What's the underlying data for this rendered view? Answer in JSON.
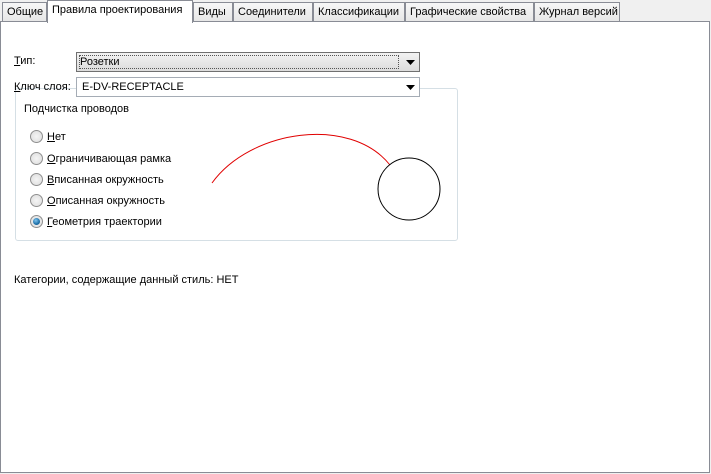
{
  "tabs": [
    {
      "label": "Общие",
      "active": false
    },
    {
      "label": "Правила проектирования",
      "active": true
    },
    {
      "label": "Виды",
      "active": false
    },
    {
      "label": "Соединители",
      "active": false
    },
    {
      "label": "Классификации",
      "active": false
    },
    {
      "label": "Графические свойства",
      "active": false
    },
    {
      "label": "Журнал версий",
      "active": false
    }
  ],
  "type_field": {
    "label_first": "Т",
    "label_rest": "ип:",
    "value": "Розетки"
  },
  "layer_key_field": {
    "label_first": "К",
    "label_rest": "люч слоя:",
    "value": "E-DV-RECEPTACLE"
  },
  "wire_cleanup": {
    "title": "Подчистка проводов",
    "options": [
      {
        "first": "Н",
        "rest": "ет",
        "selected": false
      },
      {
        "first": "О",
        "rest": "граничивающая рамка",
        "selected": false
      },
      {
        "first": "В",
        "rest": "писанная окружность",
        "selected": false
      },
      {
        "first": "О",
        "rest": "писанная окружность",
        "selected": false
      },
      {
        "first": "Г",
        "rest": "еометрия траектории",
        "selected": true
      }
    ]
  },
  "preview_colors": {
    "wire": "#e00000",
    "circle": "#000000"
  },
  "categories_text": "Категории, содержащие данный стиль: НЕТ"
}
